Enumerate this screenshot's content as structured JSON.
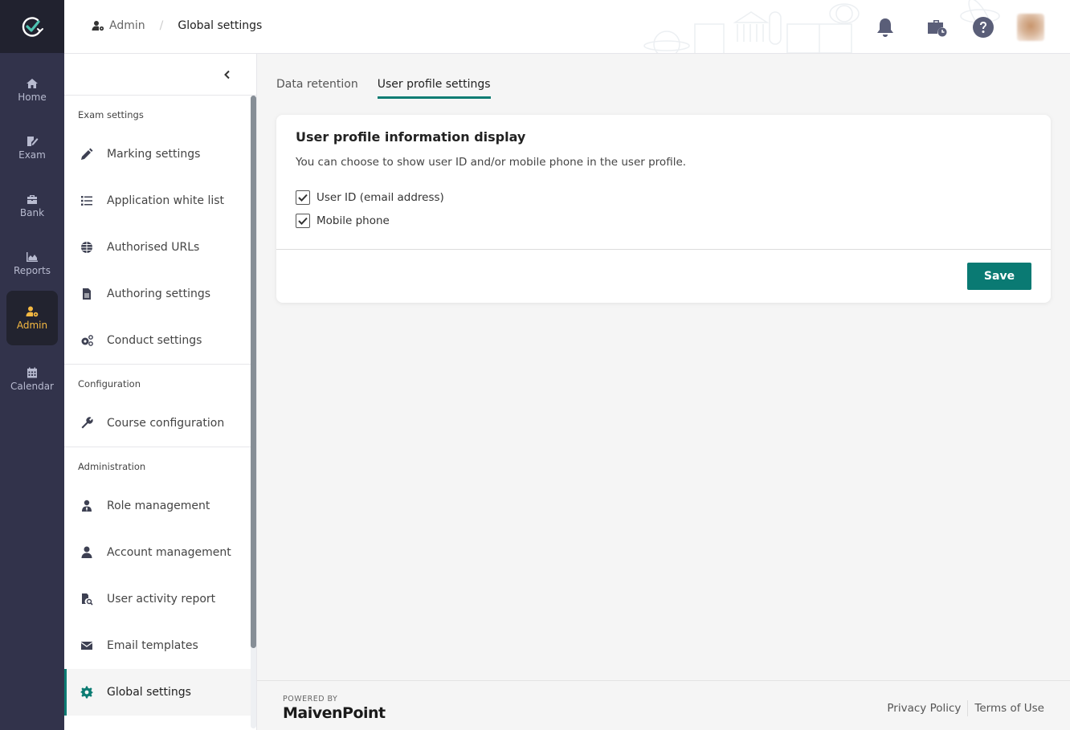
{
  "colors": {
    "accent": "#0c7c73",
    "rail_bg": "#32334b",
    "rail_active": "#f5b942"
  },
  "rail": {
    "logo": "app-logo",
    "items": [
      {
        "label": "Home",
        "icon": "home-icon"
      },
      {
        "label": "Exam",
        "icon": "exam-icon"
      },
      {
        "label": "Bank",
        "icon": "bank-icon"
      },
      {
        "label": "Reports",
        "icon": "reports-icon"
      },
      {
        "label": "Admin",
        "icon": "admin-icon",
        "active": true
      },
      {
        "label": "Calendar",
        "icon": "calendar-icon"
      }
    ]
  },
  "header": {
    "breadcrumb": {
      "parent": "Admin",
      "separator": "/",
      "current": "Global settings"
    },
    "icons": [
      "bell-icon",
      "briefcase-clock-icon",
      "help-icon",
      "avatar"
    ]
  },
  "sidebar": {
    "groups": [
      {
        "title": "Exam settings",
        "items": [
          {
            "label": "Marking settings",
            "icon": "pencil-icon"
          },
          {
            "label": "Application white list",
            "icon": "list-icon"
          },
          {
            "label": "Authorised URLs",
            "icon": "globe-icon"
          },
          {
            "label": "Authoring settings",
            "icon": "document-icon"
          },
          {
            "label": "Conduct settings",
            "icon": "gears-icon"
          }
        ]
      },
      {
        "title": "Configuration",
        "items": [
          {
            "label": "Course configuration",
            "icon": "wrench-icon"
          }
        ]
      },
      {
        "title": "Administration",
        "items": [
          {
            "label": "Role management",
            "icon": "user-tie-icon"
          },
          {
            "label": "Account management",
            "icon": "user-icon"
          },
          {
            "label": "User activity report",
            "icon": "file-search-icon"
          },
          {
            "label": "Email templates",
            "icon": "envelope-icon"
          },
          {
            "label": "Global settings",
            "icon": "gear-icon",
            "active": true
          }
        ]
      }
    ]
  },
  "main": {
    "tabs": [
      {
        "label": "Data retention",
        "active": false
      },
      {
        "label": "User profile settings",
        "active": true
      }
    ],
    "card": {
      "title": "User profile information display",
      "description": "You can choose to show user ID and/or mobile phone in the user profile.",
      "options": [
        {
          "label": "User ID (email address)",
          "checked": true
        },
        {
          "label": "Mobile phone",
          "checked": true
        }
      ],
      "save_label": "Save"
    }
  },
  "footer": {
    "powered_by": "POWERED BY",
    "brand": "MaivenPoint",
    "links": [
      "Privacy Policy",
      "Terms of Use"
    ]
  }
}
